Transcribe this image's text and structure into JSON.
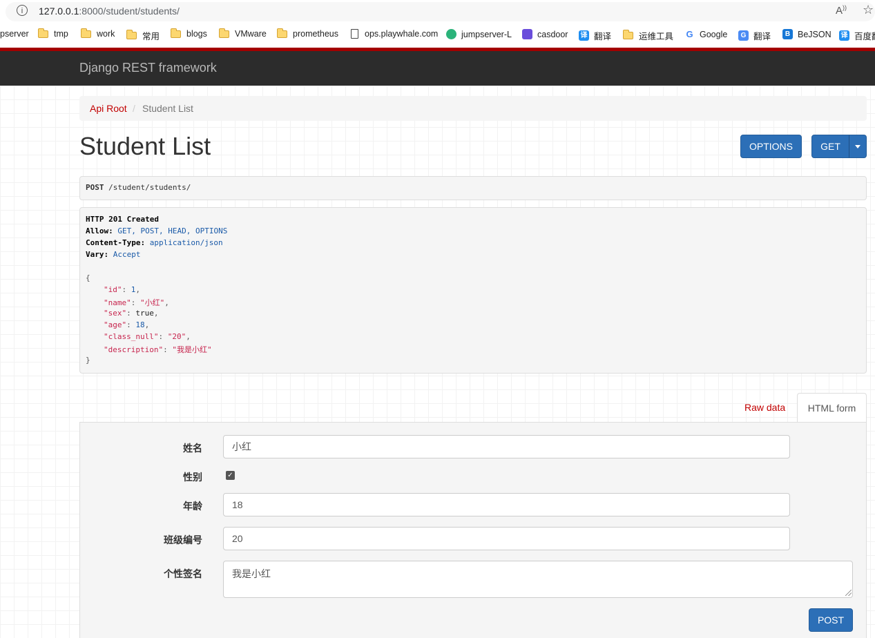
{
  "browser": {
    "url_host": "127.0.0.1",
    "url_rest": ":8000/student/students/",
    "bookmarks": [
      {
        "label": "pserver",
        "icon": "none"
      },
      {
        "label": "tmp",
        "icon": "folder-icon"
      },
      {
        "label": "work",
        "icon": "folder-icon"
      },
      {
        "label": "常用",
        "icon": "folder-icon"
      },
      {
        "label": "blogs",
        "icon": "folder-icon"
      },
      {
        "label": "VMware",
        "icon": "folder-icon"
      },
      {
        "label": "prometheus",
        "icon": "folder-icon"
      },
      {
        "label": "ops.playwhale.com",
        "icon": "page-icon"
      },
      {
        "label": "jumpserver-L",
        "icon": "jumpserver-icon"
      },
      {
        "label": "casdoor",
        "icon": "casdoor-icon"
      },
      {
        "label": "翻译",
        "icon": "translate-icon"
      },
      {
        "label": "运维工具",
        "icon": "folder-icon"
      },
      {
        "label": "Google",
        "icon": "google-icon"
      },
      {
        "label": "翻译",
        "icon": "google-translate-icon"
      },
      {
        "label": "BeJSON",
        "icon": "bejson-icon"
      },
      {
        "label": "百度翻",
        "icon": "translate-icon"
      }
    ]
  },
  "navbar": {
    "brand": "Django REST framework"
  },
  "breadcrumb": {
    "root": "Api Root",
    "separator": "/",
    "current": "Student List"
  },
  "page": {
    "title": "Student List"
  },
  "buttons": {
    "options": "OPTIONS",
    "get": "GET",
    "post": "POST"
  },
  "request": {
    "method": "POST",
    "path": " /student/students/"
  },
  "response": {
    "status": "HTTP 201 Created",
    "headers": [
      {
        "name": "Allow:",
        "value": " GET, POST, HEAD, OPTIONS"
      },
      {
        "name": "Content-Type:",
        "value": " application/json"
      },
      {
        "name": "Vary:",
        "value": " Accept"
      }
    ],
    "body_open": "{",
    "body_close": "}",
    "fields": [
      {
        "key": "\"id\"",
        "value": "1",
        "type": "number"
      },
      {
        "key": "\"name\"",
        "value": "\"小红\"",
        "type": "string"
      },
      {
        "key": "\"sex\"",
        "value": "true",
        "type": "literal"
      },
      {
        "key": "\"age\"",
        "value": "18",
        "type": "number"
      },
      {
        "key": "\"class_null\"",
        "value": "\"20\"",
        "type": "string"
      },
      {
        "key": "\"description\"",
        "value": "\"我是小红\"",
        "type": "string"
      }
    ]
  },
  "tabs": {
    "raw": "Raw data",
    "html": "HTML form"
  },
  "form": {
    "name_label": "姓名",
    "name_value": "小红",
    "sex_label": "性别",
    "sex_checked": true,
    "age_label": "年龄",
    "age_value": "18",
    "class_label": "班级编号",
    "class_value": "20",
    "desc_label": "个性签名",
    "desc_value": "我是小红"
  },
  "colors": {
    "navbar": "#2c2c2c",
    "accent_red": "#a30000",
    "link_red": "#c20000",
    "button_blue": "#2c6fb7"
  }
}
